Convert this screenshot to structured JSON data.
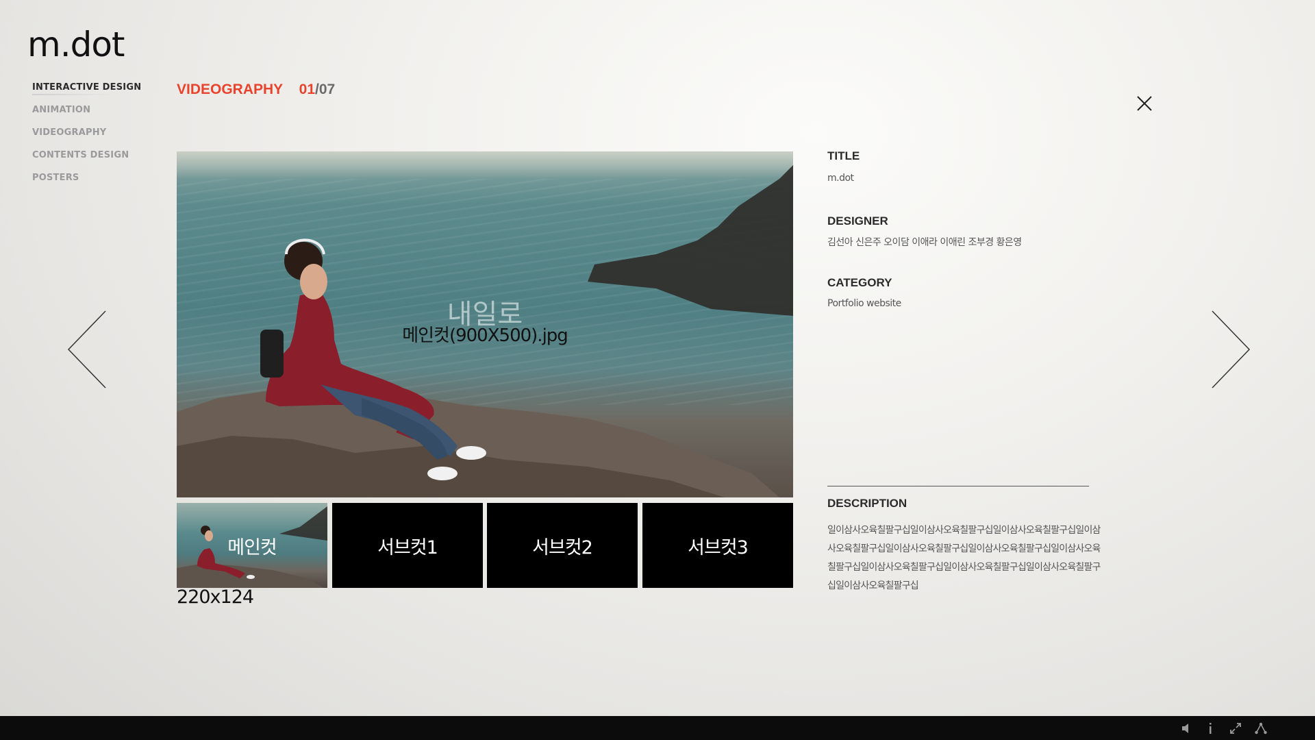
{
  "logo": {
    "text": "m.dot"
  },
  "nav": {
    "items": [
      {
        "label": "INTERACTIVE DESIGN",
        "active": true
      },
      {
        "label": "ANIMATION",
        "active": false
      },
      {
        "label": "VIDEOGRAPHY",
        "active": false
      },
      {
        "label": "CONTENTS DESIGN",
        "active": false
      },
      {
        "label": "POSTERS",
        "active": false
      }
    ]
  },
  "section": {
    "title": "VIDEOGRAPHY",
    "current": "01",
    "separator": "/",
    "total": "07"
  },
  "main_image": {
    "caption_kr": "내일로",
    "caption_file": "메인컷(900X500).jpg"
  },
  "thumbnails": [
    {
      "label": "메인컷"
    },
    {
      "label": "서브컷1"
    },
    {
      "label": "서브컷2"
    },
    {
      "label": "서브컷3"
    }
  ],
  "thumb_size_label": "220x124",
  "info": {
    "title_label": "TITLE",
    "title_value": "m.dot",
    "designer_label": "DESIGNER",
    "designer_value": "김선아 신은주 오이담 이애라 이애린 조부경 황은영",
    "category_label": "CATEGORY",
    "category_value": "Portfolio website",
    "description_label": "DESCRIPTION",
    "description_value": "일이삼사오육칠팔구십일이삼사오육칠팔구십일이삼사오육칠팔구십일이삼사오육칠팔구십일이삼사오육칠팔구십일이삼사오육칠팔구십일이삼사오육칠팔구십일이삼사오육칠팔구십일이삼사오육칠팔구십일이삼사오육칠팔구십일이삼사오육칠팔구십"
  },
  "icons": {
    "close": "close-icon",
    "prev": "chevron-left-icon",
    "next": "chevron-right-icon",
    "bottom_bar": [
      "speaker-icon",
      "info-icon",
      "fullscreen-icon",
      "share-icon"
    ]
  },
  "colors": {
    "accent": "#e8432d",
    "nav_active": "#2a2a2a",
    "nav_inactive": "#9a9a9a",
    "bottom_bar": "#0c0c0c"
  }
}
